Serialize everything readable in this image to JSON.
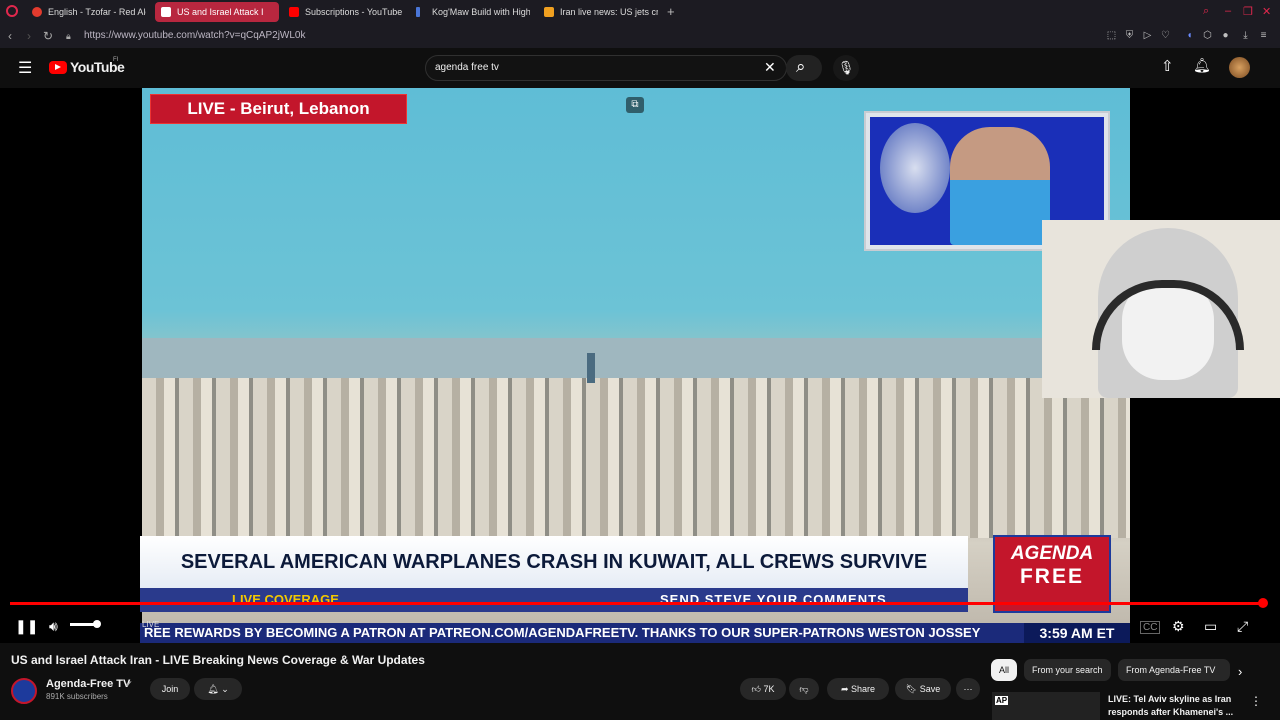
{
  "browser": {
    "tabs": [
      {
        "title": "English - Tzofar - Red Alert",
        "color": "#e33b2e"
      },
      {
        "title": "US and Israel Attack I",
        "color": "#ffffff",
        "active": true
      },
      {
        "title": "Subscriptions - YouTube",
        "color": "#ff0000"
      },
      {
        "title": "Kog'Maw Build with Highe",
        "color": "#4a76d8"
      },
      {
        "title": "Iran live news: US jets cra",
        "color": "#f0a020"
      }
    ],
    "url": "https://www.youtube.com/watch?v=qCqAP2jWL0k"
  },
  "youtube": {
    "logo_text": "YouTube",
    "country": "FI",
    "search_value": "agenda free tv"
  },
  "video": {
    "location_banner": "LIVE - Beirut, Lebanon",
    "headline": "SEVERAL AMERICAN WARPLANES CRASH IN KUWAIT, ALL CREWS SURVIVE",
    "live_coverage": "LIVE COVERAGE",
    "send_comments": "SEND STEVE YOUR COMMENTS",
    "logo_line1": "AGENDA",
    "logo_line2": "FREE",
    "ticker": "REE REWARDS BY BECOMING A PATRON AT PATREON.COM/AGENDAFREETV. THANKS TO OUR SUPER-PATRONS WESTON JOSSEY",
    "clock": "3:59 AM ET",
    "live_badge": "LIVE",
    "progress": 1.0
  },
  "page": {
    "title": "US and Israel Attack Iran - LIVE Breaking News Coverage & War Updates",
    "channel_name": "Agenda-Free TV",
    "subscribers": "891K subscribers",
    "join_label": "Join",
    "likes": "7K",
    "share_label": "Share",
    "save_label": "Save"
  },
  "filters": [
    "All",
    "From your search",
    "From Agenda-Free TV"
  ],
  "recommendation": {
    "title_line1": "LIVE: Tel Aviv skyline as Iran",
    "title_line2": "responds after Khamenei's ..."
  }
}
